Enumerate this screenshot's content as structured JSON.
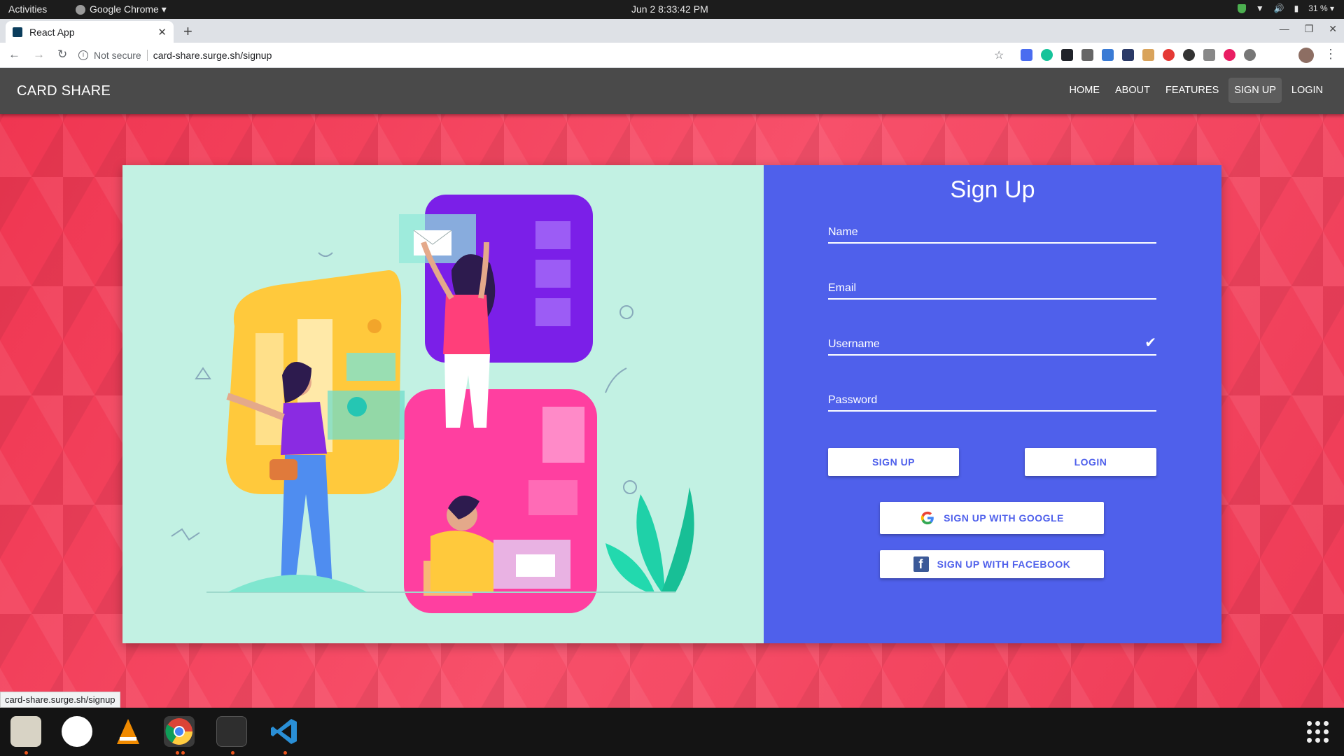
{
  "system": {
    "activities": "Activities",
    "app_menu": "Google Chrome ▾",
    "clock": "Jun 2   8:33:42 PM",
    "battery": "31 % ▾"
  },
  "browser": {
    "tab_title": "React App",
    "tab_close": "✕",
    "new_tab": "+",
    "not_secure": "Not secure",
    "url": "card-share.surge.sh/signup",
    "status_url": "card-share.surge.sh/signup"
  },
  "app": {
    "brand": "CARD SHARE",
    "nav": [
      "HOME",
      "ABOUT",
      "FEATURES",
      "SIGN UP",
      "LOGIN"
    ],
    "active_nav": "SIGN UP"
  },
  "form": {
    "title": "Sign Up",
    "fields": {
      "name": "Name",
      "email": "Email",
      "username": "Username",
      "password": "Password"
    },
    "signup_button": "SIGN UP",
    "login_button": "LOGIN",
    "google_button": "SIGN UP WITH GOOGLE",
    "facebook_button": "SIGN UP WITH FACEBOOK"
  },
  "colors": {
    "appbar": "#4a4a4a",
    "form_bg": "#4f60eb",
    "illustration_bg": "#c2f1e3",
    "page_bg": "#f23b55"
  }
}
